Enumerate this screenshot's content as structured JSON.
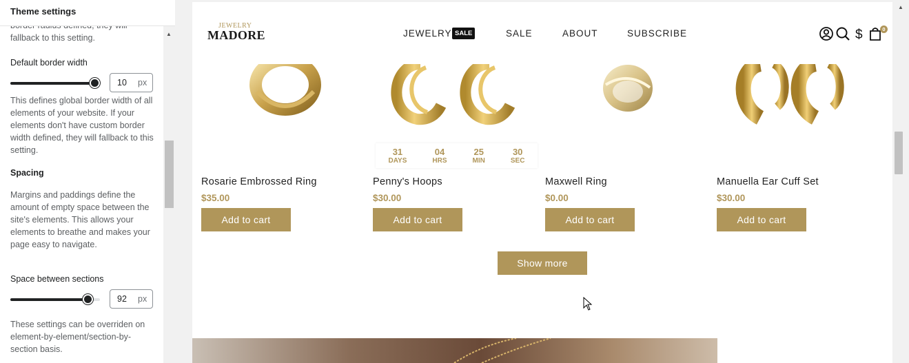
{
  "panel": {
    "title": "Theme settings",
    "clipped_text": "border radius defined, they will",
    "fallback_text": "fallback to this setting.",
    "border_width": {
      "label": "Default border width",
      "value": "10",
      "unit": "px",
      "level": 1.0,
      "description": "This defines global border width of all elements of your website. If your elements don't have custom border width defined, they will fallback to this setting."
    },
    "spacing": {
      "heading": "Spacing",
      "description": "Margins and paddings define the amount of empty space between the site's elements. This allows your elements to breathe and makes your page easy to navigate."
    },
    "space_between": {
      "label": "Space between sections",
      "value": "92",
      "unit": "px",
      "level": 0.92,
      "description": "These settings can be overriden on element-by-element/section-by-section basis."
    }
  },
  "store": {
    "logo_small": "JEWELRY",
    "logo_big": "MADORE",
    "nav": {
      "jewelry": "JEWELRY",
      "sale_badge": "SALE",
      "sale": "SALE",
      "about": "ABOUT",
      "subscribe": "SUBSCRIBE"
    },
    "cart_count": "0",
    "icons": [
      "account-icon",
      "search-icon",
      "currency-icon",
      "cart-icon"
    ],
    "accent_color": "#b0965a"
  },
  "countdown": {
    "days": "31",
    "days_label": "DAYS",
    "hrs": "04",
    "hrs_label": "HRS",
    "min": "25",
    "min_label": "MIN",
    "sec": "30",
    "sec_label": "SEC"
  },
  "products": [
    {
      "name": "Rosarie Embrossed Ring",
      "price": "$35.00",
      "button": "Add to cart"
    },
    {
      "name": "Penny's Hoops",
      "price": "$30.00",
      "button": "Add to cart"
    },
    {
      "name": "Maxwell Ring",
      "price": "$0.00",
      "button": "Add to cart"
    },
    {
      "name": "Manuella Ear Cuff Set",
      "price": "$30.00",
      "button": "Add to cart"
    }
  ],
  "show_more": "Show more"
}
